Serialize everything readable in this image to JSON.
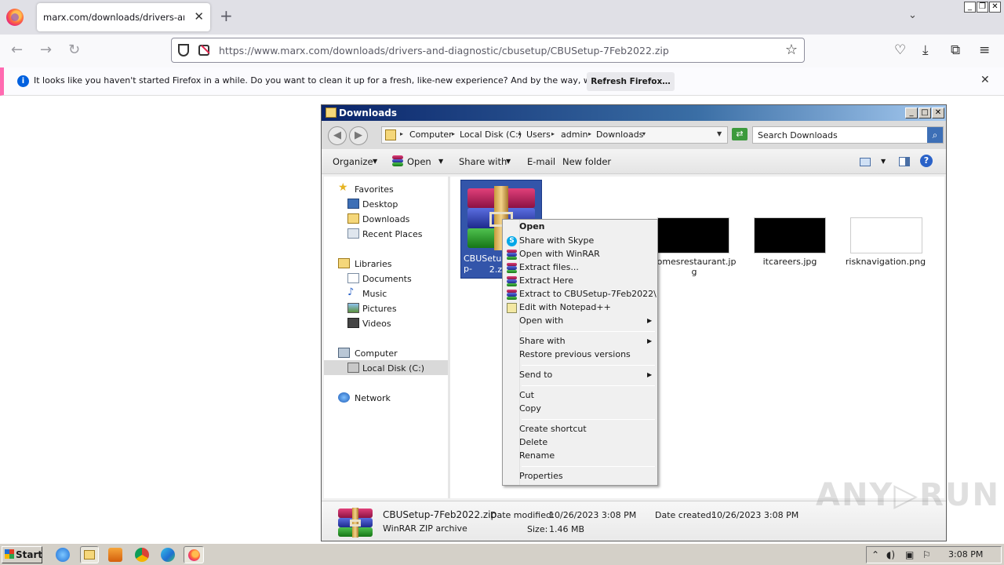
{
  "browser": {
    "tab_title": "marx.com/downloads/drivers-and-diagn",
    "tab_close": "✕",
    "new_tab": "+",
    "tab_list": "⌄",
    "url": "https://www.marx.com/downloads/drivers-and-diagnostic/cbusetup/CBUSetup-7Feb2022.zip",
    "notification": {
      "text": "It looks like you haven't started Firefox in a while. Do you want to clean it up for a fresh, like-new experience? And by the way, welcome back!",
      "button": "Refresh Firefox…",
      "close": "✕"
    }
  },
  "explorer": {
    "title": "Downloads",
    "breadcrumb": [
      "Computer",
      "Local Disk (C:)",
      "Users",
      "admin",
      "Downloads"
    ],
    "search_placeholder": "Search Downloads",
    "toolbar": {
      "organize": "Organize",
      "open": "Open",
      "share_with": "Share with",
      "email": "E-mail",
      "new_folder": "New folder"
    },
    "nav": {
      "favorites": "Favorites",
      "desktop": "Desktop",
      "downloads": "Downloads",
      "recent_places": "Recent Places",
      "libraries": "Libraries",
      "documents": "Documents",
      "music": "Music",
      "pictures": "Pictures",
      "videos": "Videos",
      "computer": "Computer",
      "local_disk": "Local Disk (C:)",
      "network": "Network"
    },
    "files": [
      {
        "name": "CBUSetup-7Feb2022.zip",
        "shown": "CBUSetup-",
        "shown2": "2.z",
        "selected": true
      },
      {
        "name": "comesrestaurant.jpg",
        "shown": "comesrestaurant.jp",
        "shown2": "g"
      },
      {
        "name": "itcareers.jpg",
        "shown": "itcareers.jpg"
      },
      {
        "name": "risknavigation.png",
        "shown": "risknavigation.png"
      }
    ],
    "status": {
      "filename": "CBUSetup-7Feb2022.zip",
      "type": "WinRAR ZIP archive",
      "modified_label": "Date modified:",
      "modified": "10/26/2023 3:08 PM",
      "created_label": "Date created:",
      "created": "10/26/2023 3:08 PM",
      "size_label": "Size:",
      "size": "1.46 MB"
    }
  },
  "context_menu": {
    "items": [
      {
        "label": "Open",
        "bold": true
      },
      {
        "label": "Share with Skype",
        "icon": "skype-icon"
      },
      {
        "label": "Open with WinRAR",
        "icon": "winrar-icon"
      },
      {
        "label": "Extract files...",
        "icon": "winrar-icon"
      },
      {
        "label": "Extract Here",
        "icon": "winrar-icon"
      },
      {
        "label": "Extract to CBUSetup-7Feb2022\\",
        "icon": "winrar-icon"
      },
      {
        "label": "Edit with Notepad++",
        "icon": "notepadpp-icon"
      },
      {
        "label": "Open with",
        "submenu": true
      },
      {
        "label": "Share with",
        "submenu": true
      },
      {
        "label": "Restore previous versions"
      },
      {
        "label": "Send to",
        "submenu": true
      },
      {
        "label": "Cut"
      },
      {
        "label": "Copy"
      },
      {
        "label": "Create shortcut"
      },
      {
        "label": "Delete"
      },
      {
        "label": "Rename"
      },
      {
        "label": "Properties"
      }
    ]
  },
  "taskbar": {
    "start": "Start",
    "clock": "3:08 PM"
  },
  "watermark": "ANY▷RUN"
}
